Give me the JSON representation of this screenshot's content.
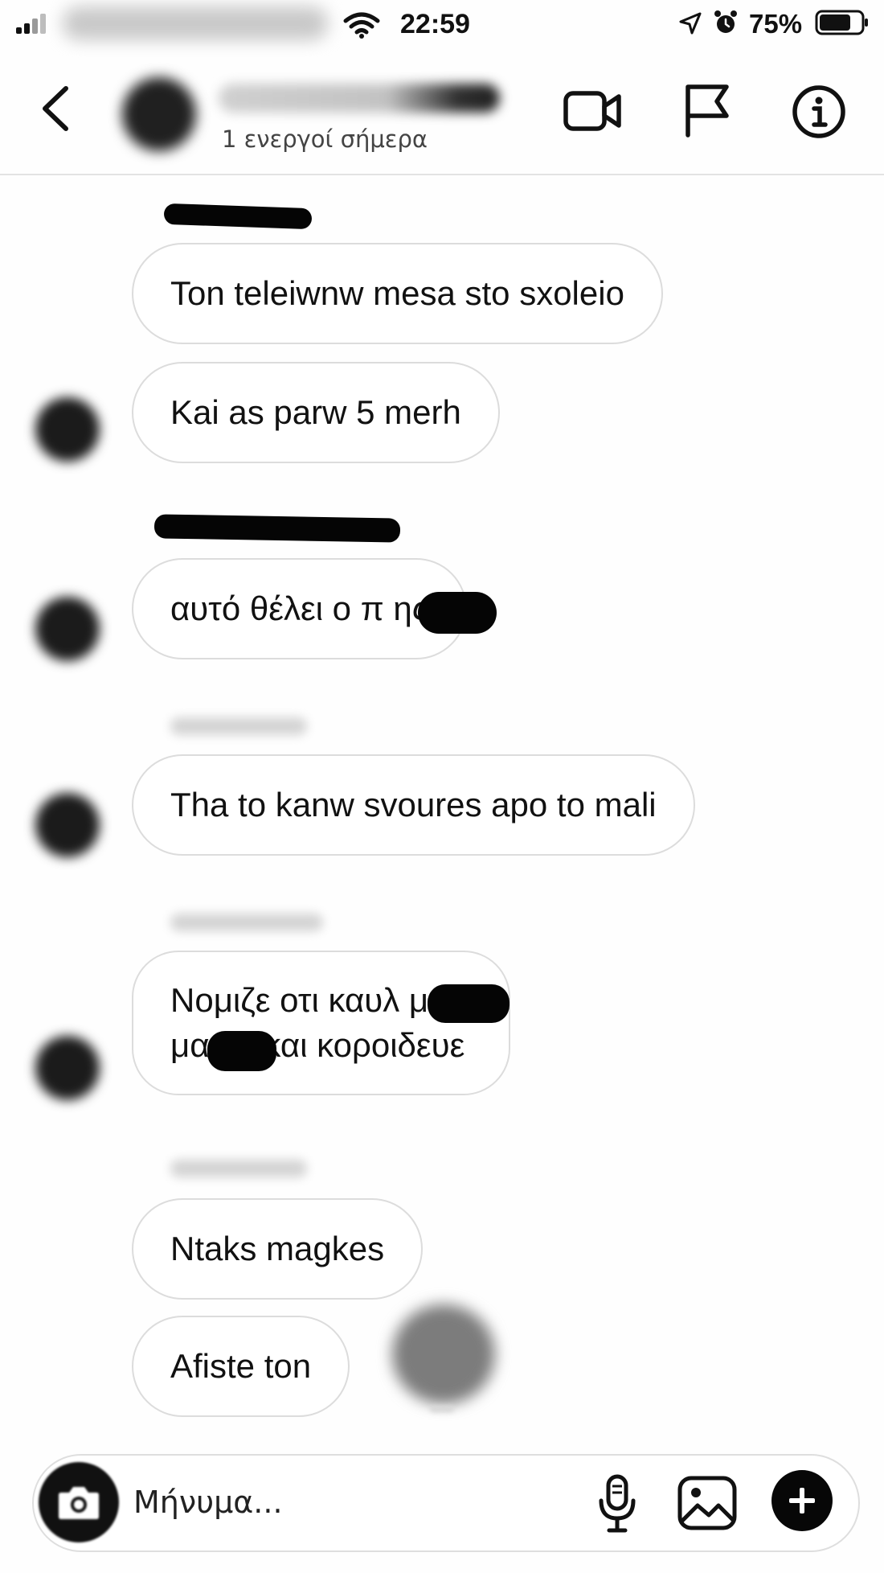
{
  "status_bar": {
    "time": "22:59",
    "battery_percent": "75%",
    "battery_level": 0.75,
    "icons": [
      "signal-icon",
      "wifi-icon",
      "location-icon",
      "alarm-icon",
      "battery-icon"
    ]
  },
  "header": {
    "active_status": "1 ενεργοί σήμερα",
    "icons": [
      "back-arrow-icon",
      "video-call-icon",
      "flag-icon",
      "info-icon"
    ]
  },
  "messages": [
    {
      "text": "Ton teleiwnw mesa sto sxoleio"
    },
    {
      "text": "Kai as parw 5 merh"
    },
    {
      "text": "αυτό θέλει ο π      ης"
    },
    {
      "text": "Tha to kanw svoures apo to mali"
    },
    {
      "line1": "Νομιζε οτι καυλ        με ο",
      "line2": "μα      ας και κοροιδευε"
    },
    {
      "text": "Ntaks magkes"
    },
    {
      "text": "Afiste ton"
    }
  ],
  "composer": {
    "placeholder": "Μήνυμα...",
    "icons": [
      "camera-icon",
      "microphone-icon",
      "gallery-icon",
      "plus-icon"
    ]
  },
  "colors": {
    "bubble_border": "#dcdcdc",
    "text": "#111111",
    "redaction": "#050505"
  }
}
